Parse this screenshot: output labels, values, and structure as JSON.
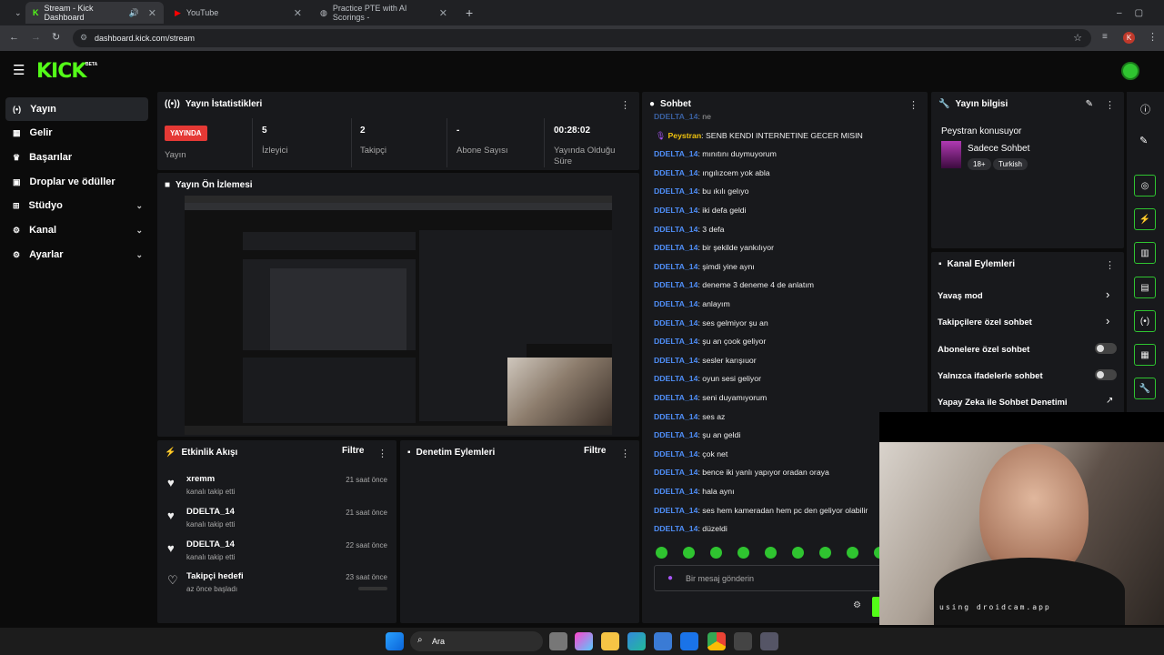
{
  "browser": {
    "tabs": [
      {
        "title": "Stream - Kick Dashboard"
      },
      {
        "title": "YouTube"
      },
      {
        "title": "Practice PTE with AI Scorings -"
      }
    ],
    "url": "dashboard.kick.com/stream",
    "profile_initial": "K"
  },
  "brand": {
    "logo": "KICK",
    "beta": "BETA",
    "accent": "#53fc18"
  },
  "sidebar": {
    "items": [
      {
        "label": "Yayın",
        "icon": "broadcast-icon"
      },
      {
        "label": "Gelir",
        "icon": "bank-icon"
      },
      {
        "label": "Başarılar",
        "icon": "trophy-icon"
      },
      {
        "label": "Droplar ve ödüller",
        "icon": "gift-icon"
      },
      {
        "label": "Stüdyo",
        "icon": "grid-icon"
      },
      {
        "label": "Kanal",
        "icon": "settings-icon"
      },
      {
        "label": "Ayarlar",
        "icon": "gear-icon"
      }
    ]
  },
  "stats": {
    "title": "Yayın İstatistikleri",
    "badge": "YAYINDA",
    "badge_label": "Yayın",
    "items": [
      {
        "value": "5",
        "label": "İzleyici"
      },
      {
        "value": "2",
        "label": "Takipçi"
      },
      {
        "value": "-",
        "label": "Abone Sayısı"
      },
      {
        "value": "00:28:02",
        "label": "Yayında Olduğu Süre"
      }
    ]
  },
  "preview": {
    "title": "Yayın Ön İzlemesi"
  },
  "activity": {
    "title": "Etkinlik Akışı",
    "filter": "Filtre",
    "items": [
      {
        "name": "xremm",
        "sub": "kanalı takip etti",
        "time": "21 saat önce"
      },
      {
        "name": "DDELTA_14",
        "sub": "kanalı takip etti",
        "time": "21 saat önce"
      },
      {
        "name": "DDELTA_14",
        "sub": "kanalı takip etti",
        "time": "22 saat önce"
      },
      {
        "name": "Takipçi hedefi",
        "sub": "az önce başladı",
        "time": "23 saat önce"
      }
    ]
  },
  "moderation": {
    "title": "Denetim Eylemleri",
    "filter": "Filtre"
  },
  "chat": {
    "title": "Sohbet",
    "placeholder": "Bir mesaj gönderin",
    "messages": [
      {
        "user": "DDELTA_14",
        "text": ": ne"
      },
      {
        "user": "Peystran",
        "text": ": SENB KENDI INTERNETINE GECER MISIN"
      },
      {
        "user": "DDELTA_14",
        "text": ": mınıtını duymuyorum"
      },
      {
        "user": "DDELTA_14",
        "text": ": ıngılızcem yok abla"
      },
      {
        "user": "DDELTA_14",
        "text": ": bu ıkılı gelıyo"
      },
      {
        "user": "DDELTA_14",
        "text": ": iki defa geldi"
      },
      {
        "user": "DDELTA_14",
        "text": ": 3 defa"
      },
      {
        "user": "DDELTA_14",
        "text": ": bir şekilde yankılıyor"
      },
      {
        "user": "DDELTA_14",
        "text": ": şimdi yine aynı"
      },
      {
        "user": "DDELTA_14",
        "text": ": deneme 3 deneme 4 de anlatım"
      },
      {
        "user": "DDELTA_14",
        "text": ": anlayım"
      },
      {
        "user": "DDELTA_14",
        "text": ": ses gelmiyor şu an"
      },
      {
        "user": "DDELTA_14",
        "text": ": şu an çook geliyor"
      },
      {
        "user": "DDELTA_14",
        "text": ": sesler karışıuor"
      },
      {
        "user": "DDELTA_14",
        "text": ": oyun sesi geliyor"
      },
      {
        "user": "DDELTA_14",
        "text": ": seni duyamıyorum"
      },
      {
        "user": "DDELTA_14",
        "text": ": ses az"
      },
      {
        "user": "DDELTA_14",
        "text": ": şu an geldi"
      },
      {
        "user": "DDELTA_14",
        "text": ": çok net"
      },
      {
        "user": "DDELTA_14",
        "text": ": bence iki yanlı yapıyor oradan oraya"
      },
      {
        "user": "DDELTA_14",
        "text": ": hala aynı"
      },
      {
        "user": "DDELTA_14",
        "text": ": ses hem kameradan hem pc den geliyor olabilir"
      },
      {
        "user": "DDELTA_14",
        "text": ": düzeldi"
      }
    ]
  },
  "streaminfo": {
    "title": "Yayın bilgisi",
    "stream_title": "Peystran konusuyor",
    "category": "Sadece Sohbet",
    "tags": [
      "18+",
      "Turkish"
    ]
  },
  "channel_actions": {
    "title": "Kanal Eylemleri",
    "items": [
      {
        "label": "Yavaş mod"
      },
      {
        "label": "Takipçilere özel sohbet"
      },
      {
        "label": "Abonelere özel sohbet"
      },
      {
        "label": "Yalnızca ifadelerle sohbet"
      },
      {
        "label": "Yapay Zeka ile Sohbet Denetimi"
      }
    ]
  },
  "webcam": {
    "watermark": "using droidcam.app"
  },
  "taskbar": {
    "search": "Ara"
  }
}
